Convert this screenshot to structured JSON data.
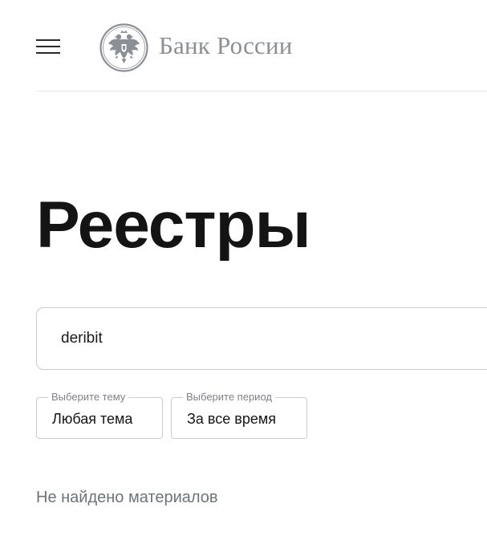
{
  "header": {
    "brand_name": "Банк России",
    "menu_icon": "hamburger-menu-icon",
    "emblem_icon": "double-headed-eagle-icon",
    "brand_color": "#8b8f96"
  },
  "main": {
    "title": "Реестры",
    "search": {
      "value": "deribit"
    },
    "filters": [
      {
        "label": "Выберите тему",
        "value": "Любая тема"
      },
      {
        "label": "Выберите период",
        "value": "За все время"
      }
    ],
    "empty_message": "Не найдено материалов"
  }
}
